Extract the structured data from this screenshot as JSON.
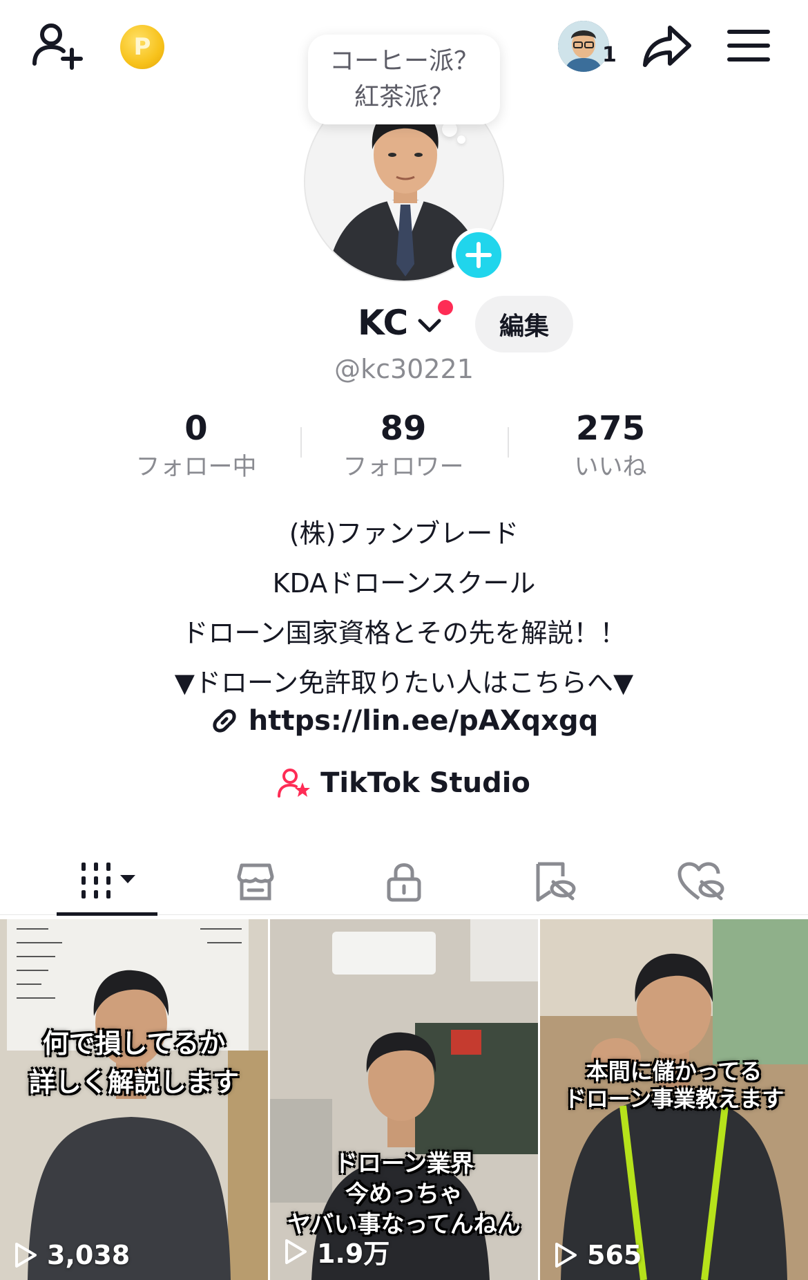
{
  "topbar": {
    "friends_count": "1",
    "coin_letter": "P"
  },
  "profile": {
    "bubble_line1": "コーヒー派？",
    "bubble_line2": "紅茶派？",
    "username": "KC",
    "edit_label": "編集",
    "handle": "@kc30221"
  },
  "stats": [
    {
      "value": "0",
      "label": "フォロー中"
    },
    {
      "value": "89",
      "label": "フォロワー"
    },
    {
      "value": "275",
      "label": "いいね"
    }
  ],
  "bio": {
    "line1": "(株)ファンブレード",
    "line2": "KDAドローンスクール",
    "line3": "ドローン国家資格とその先を解説！！",
    "line4": "▼ドローン免許取りたい人はこちらへ▼"
  },
  "link": {
    "text": "https://lin.ee/pAXqxgq"
  },
  "studio": {
    "label": "TikTok Studio"
  },
  "tabs": [
    {
      "name": "videos",
      "icon": "grid-icon"
    },
    {
      "name": "shop",
      "icon": "shop-icon"
    },
    {
      "name": "private",
      "icon": "lock-icon"
    },
    {
      "name": "saved",
      "icon": "bookmark-hidden-icon"
    },
    {
      "name": "liked",
      "icon": "heart-hidden-icon"
    }
  ],
  "videos": [
    {
      "caption1": "何で損してるか",
      "caption2": "詳しく解説します",
      "caption3": "",
      "views": "3,038"
    },
    {
      "caption1": "ドローン業界",
      "caption2": "今めっちゃ",
      "caption3": "ヤバい事なってんねん",
      "views": "1.9万"
    },
    {
      "caption1": "本間に儲かってる",
      "caption2": "ドローン事業教えます",
      "caption3": "",
      "views": "565"
    }
  ],
  "colors": {
    "accent": "#fe2c55",
    "plus": "#20d5ec",
    "coin": "#f7c21b"
  }
}
